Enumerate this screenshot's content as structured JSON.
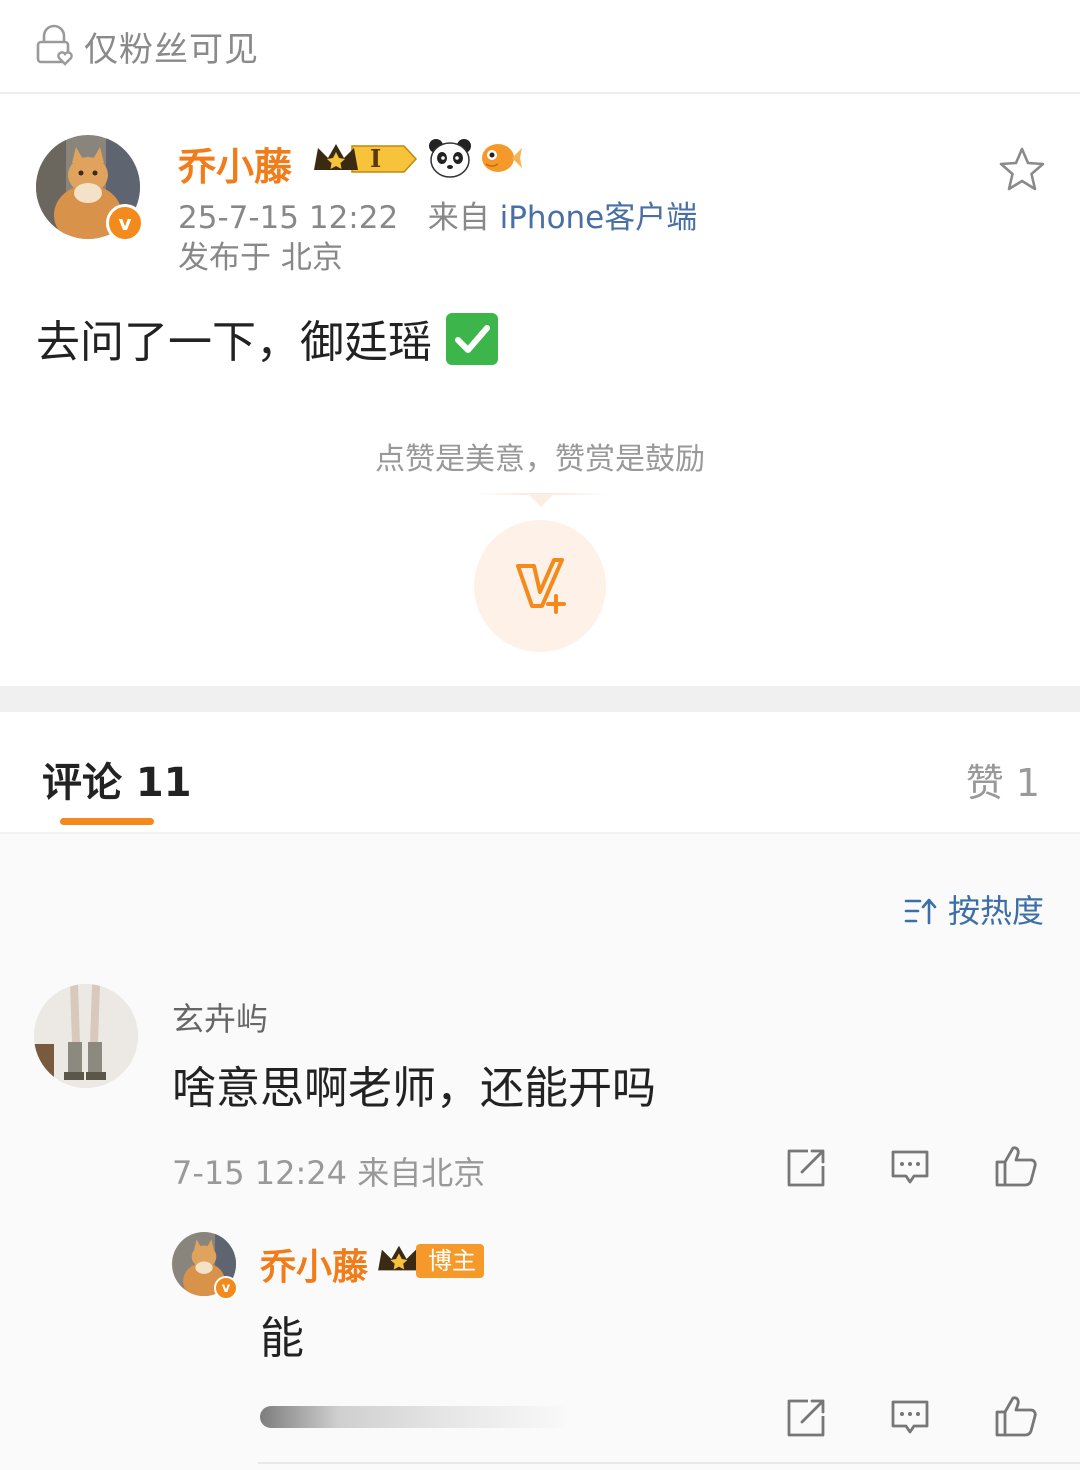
{
  "top_bar": {
    "visibility": "仅粉丝可见",
    "lock_icon": "lock-heart-icon"
  },
  "post": {
    "author": "乔小藤",
    "date": "25-7-15 12:22",
    "from_prefix": "来自",
    "source": "iPhone客户端",
    "location": "发布于 北京",
    "content": "去问了一下，御廷瑶",
    "rank_badge_text": "I",
    "reward_prompt": "点赞是美意，赞赏是鼓励",
    "colors": {
      "username": "#f07c1a",
      "accent": "#f28a1c",
      "link": "#4a6fa5"
    }
  },
  "tabs": {
    "comment_label": "评论 11",
    "like_label": "赞 1"
  },
  "sort": {
    "label": "按热度"
  },
  "comments": [
    {
      "user": "玄卉屿",
      "text": "啥意思啊老师，还能开吗",
      "time": "7-15 12:24 来自北京",
      "reply": {
        "user": "乔小藤",
        "badge": "博主",
        "text": "能"
      }
    }
  ]
}
